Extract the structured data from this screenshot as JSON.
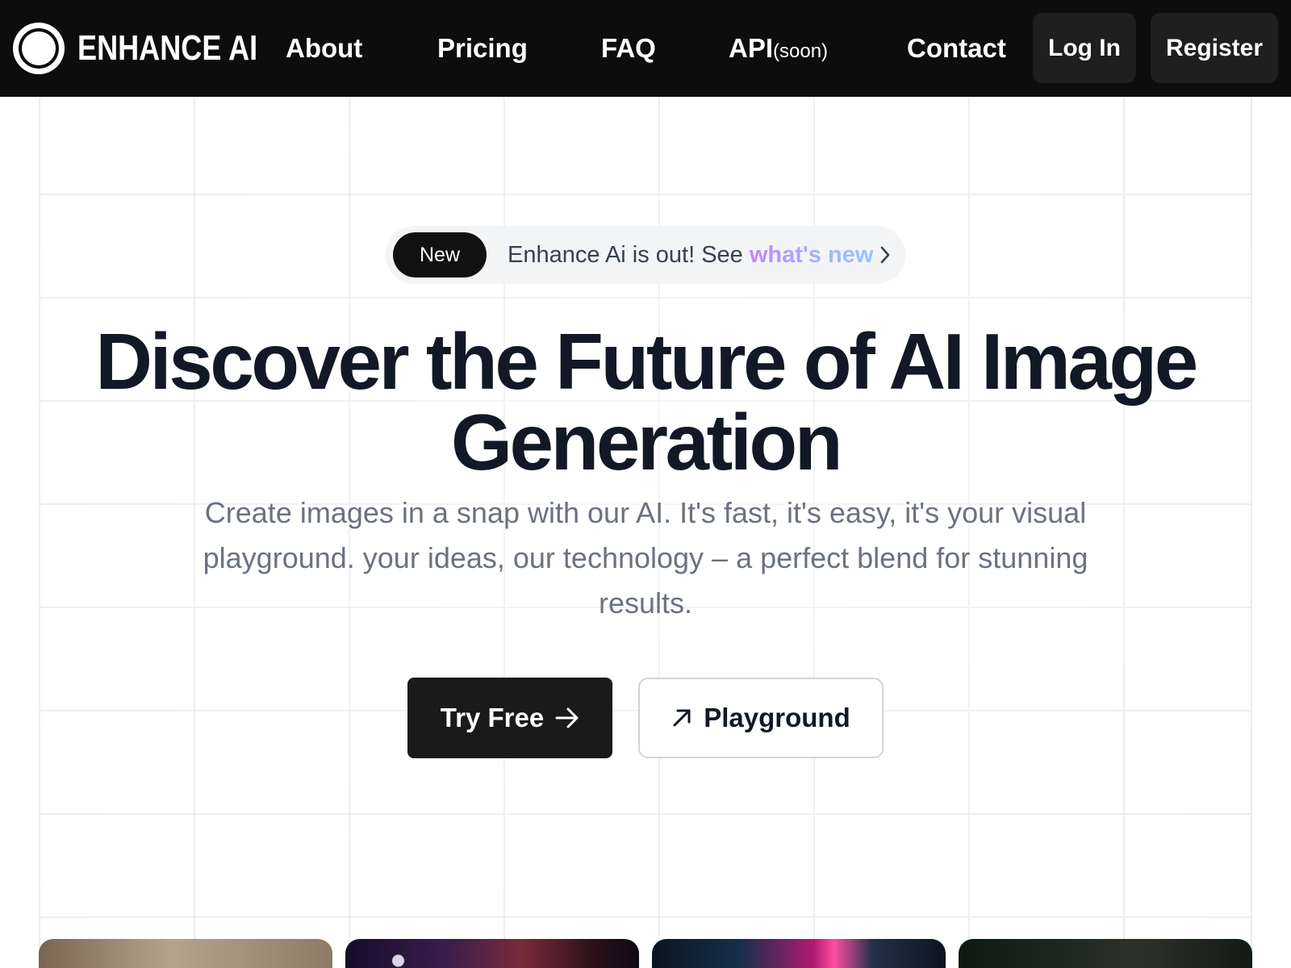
{
  "navbar": {
    "brand_name": "ENHANCE AI",
    "links": [
      {
        "label": "About"
      },
      {
        "label": "Pricing"
      },
      {
        "label": "FAQ"
      },
      {
        "label": "API",
        "suffix": "(soon)"
      },
      {
        "label": "Contact"
      }
    ],
    "login_label": "Log In",
    "register_label": "Register"
  },
  "announcement": {
    "badge": "New",
    "text": "Enhance Ai is out! See ",
    "highlight": "what's new",
    "icon": "chevron-right-icon"
  },
  "hero": {
    "title": "Discover the Future of AI Image Generation",
    "subtitle": "Create images in a snap with our AI. It's fast, it's easy, it's your visual playground. your ideas, our technology – a perfect blend for stunning results."
  },
  "cta": {
    "primary_label": "Try Free",
    "primary_icon": "arrow-right-icon",
    "secondary_label": "Playground",
    "secondary_icon": "arrow-up-right-icon"
  },
  "colors": {
    "navbar_bg": "#0d0d0d",
    "title_text": "#121826",
    "subtitle_text": "#6b7280",
    "highlight_gradient_start": "#c084fc",
    "highlight_gradient_end": "#93c5fd"
  }
}
